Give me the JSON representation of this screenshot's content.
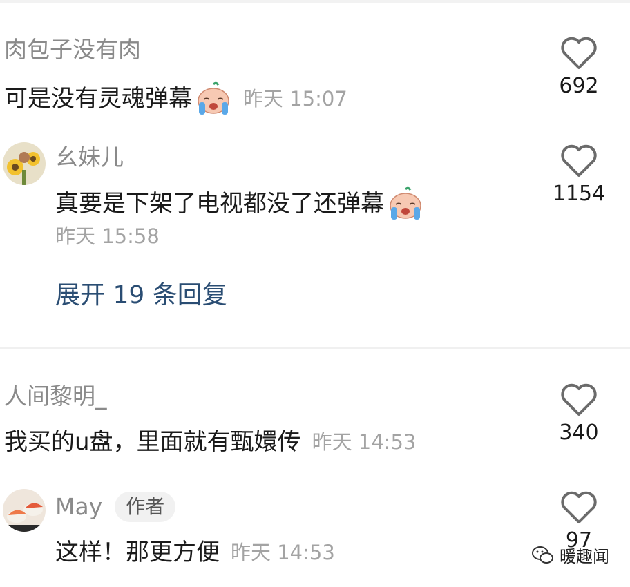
{
  "comments": [
    {
      "username": "肉包子没有肉",
      "text": "可是没有灵魂弹幕",
      "emoji": "crying-emoji",
      "time": "昨天 15:07",
      "likes": "692",
      "replies": [
        {
          "username": "幺妹儿",
          "text": "真要是下架了电视都没了还弹幕",
          "emoji": "crying-emoji",
          "time": "昨天 15:58",
          "likes": "1154"
        }
      ],
      "expand_label": "展开 19 条回复"
    },
    {
      "username": "人间黎明_",
      "text": "我买的u盘，里面就有甄嬛传",
      "time": "昨天 14:53",
      "likes": "340",
      "replies": [
        {
          "username": "May",
          "badge": "作者",
          "text": "这样！那更方便",
          "time": "昨天 14:53",
          "likes": "97"
        }
      ]
    }
  ],
  "watermark": {
    "text": "暖趣闻",
    "icon": "wechat-icon"
  },
  "colors": {
    "username": "#8a8a8a",
    "content": "#1a1a1a",
    "timestamp": "#a3a3a3",
    "link": "#2a4d73"
  }
}
